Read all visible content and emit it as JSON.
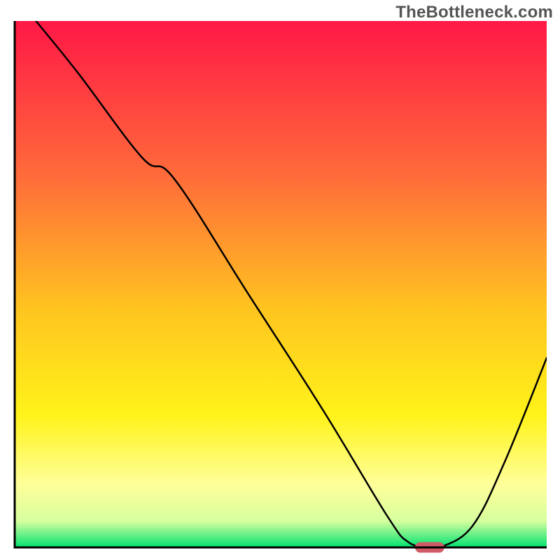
{
  "watermark": {
    "text": "TheBottleneck.com"
  },
  "chart_data": {
    "type": "line",
    "title": "",
    "xlabel": "",
    "ylabel": "",
    "xlim": [
      0,
      100
    ],
    "ylim": [
      0,
      100
    ],
    "grid": false,
    "legend": false,
    "background_gradient": {
      "stops": [
        {
          "offset": 0.0,
          "color": "#ff1846"
        },
        {
          "offset": 0.3,
          "color": "#ff6d3a"
        },
        {
          "offset": 0.55,
          "color": "#ffc51f"
        },
        {
          "offset": 0.75,
          "color": "#fff31a"
        },
        {
          "offset": 0.88,
          "color": "#ffff9a"
        },
        {
          "offset": 0.95,
          "color": "#d7ff9e"
        },
        {
          "offset": 1.0,
          "color": "#00e272"
        }
      ]
    },
    "series": [
      {
        "name": "bottleneck-curve",
        "color": "#000000",
        "x": [
          4,
          12,
          24,
          30,
          44,
          58,
          70,
          74,
          78,
          80,
          86,
          92,
          100
        ],
        "values": [
          100,
          90,
          74,
          70,
          48,
          26,
          6,
          1,
          0,
          0,
          4,
          16,
          36
        ]
      }
    ],
    "marker": {
      "name": "optimum-marker",
      "color": "#d05a66",
      "x": 78,
      "y": 0,
      "width": 5.5,
      "height": 2
    }
  }
}
